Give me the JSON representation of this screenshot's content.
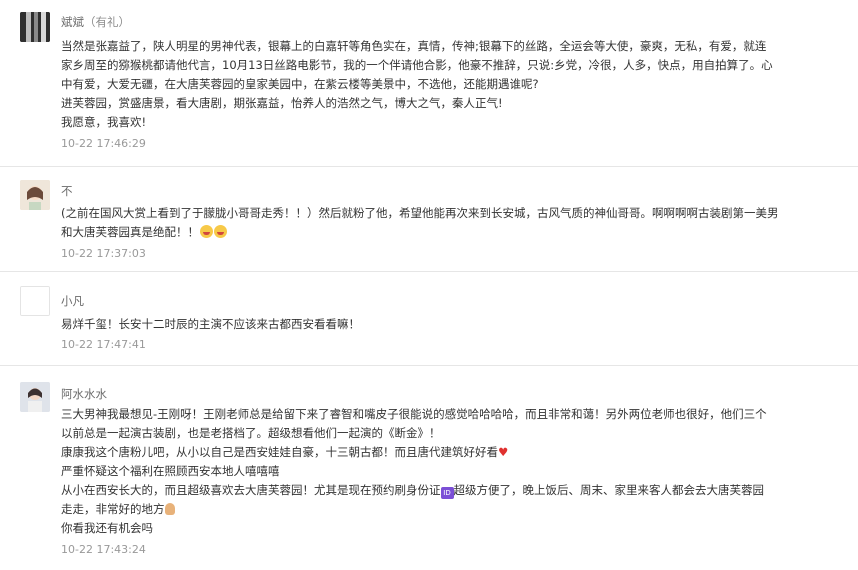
{
  "comments": [
    {
      "name": "斌斌",
      "name_note": "（有礼）",
      "lines": [
        "当然是张嘉益了，陕人明星的男神代表，银幕上的白嘉轩等角色实在，真情，传神;银幕下的丝路，全运会等大使，豪爽，无私，有爱，就连",
        "家乡周至的猕猴桃都请他代言，10月13日丝路电影节，我的一个伴请他合影，他豪不推辞，只说:乡党，冷很，人多，快点，用自拍算了。心",
        "中有爱，大爱无疆，在大唐芙蓉园的皇家美园中，在紫云楼等美景中，不选他，还能期遇谁呢?",
        "进芙蓉园，赏盛唐景，看大唐剧，期张嘉益，怡养人的浩然之气，博大之气，秦人正气!",
        "我愿意，我喜欢!"
      ],
      "time": "10-22 17:46:29"
    },
    {
      "name": "不",
      "lines": [
        "(之前在国风大赏上看到了于朦胧小哥哥走秀！！）然后就粉了他，希望他能再次来到长安城，古风气质的神仙哥哥。啊啊啊啊古装剧第一美男",
        "和大唐芙蓉园真是绝配！！"
      ],
      "time": "10-22 17:37:03"
    },
    {
      "name": "小凡",
      "lines": [
        "易烊千玺！长安十二时辰的主演不应该来古都西安看看嘛！"
      ],
      "time": "10-22 17:47:41"
    },
    {
      "name": "阿水水水",
      "lines": [
        "三大男神我最想见-王刚呀！王刚老师总是给留下来了睿智和嘴皮子很能说的感觉哈哈哈哈，而且非常和蔼！另外两位老师也很好，他们三个",
        "以前总是一起演古装剧，也是老搭档了。超级想看他们一起演的《断金》！",
        "康康我这个唐粉儿吧，从小以自己是西安娃娃自豪，十三朝古都！而且唐代建筑好好看",
        "严重怀疑这个福利在照顾西安本地人嘻嘻嘻",
        "从小在西安长大的，而且超级喜欢去大唐芙蓉园！尤其是现在预约刷身份证",
        "走走，非常好的地方",
        "你看我还有机会吗"
      ],
      "extra": {
        "line4_after": "超级方便了，晚上饭后、周末、家里来客人都会去大唐芙蓉园"
      },
      "time": "10-22 17:43:24"
    }
  ],
  "icons": {
    "avatar_1": "avatar-photo",
    "avatar_2": "avatar-girl",
    "avatar_3": "avatar-blank",
    "avatar_4": "avatar-girl-2",
    "emoji_face": "laughing-face-emoji",
    "emoji_heart": "heart-emoji",
    "emoji_id": "id-button-emoji",
    "emoji_ok": "ok-hand-emoji"
  }
}
